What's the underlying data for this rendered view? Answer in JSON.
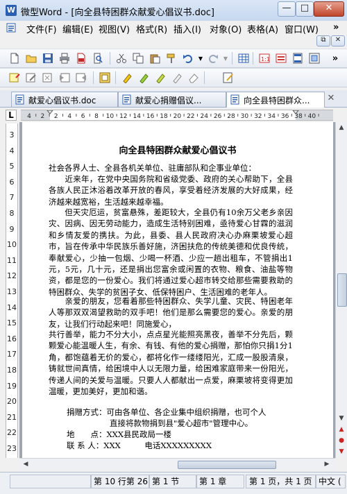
{
  "window": {
    "title": "微型Word - [向全县特困群众献爱心倡议书.doc]",
    "app_icon": "W",
    "min": "—",
    "max": "□",
    "close": "✕",
    "sub_restore": "⧉",
    "sub_close": "✕"
  },
  "menu": [
    {
      "label": "文件(F)"
    },
    {
      "label": "编辑(E)"
    },
    {
      "label": "视图(V)"
    },
    {
      "label": "格式(R)"
    },
    {
      "label": "插入(I)"
    },
    {
      "label": "对象(O)"
    },
    {
      "label": "表格(A)"
    },
    {
      "label": "窗口(W)"
    }
  ],
  "menu_overflow": "»",
  "toolbar1": [
    "new-doc-icon",
    "open-icon",
    "save-icon",
    "print-icon",
    "pdf-icon",
    "print-preview-icon",
    "cut-icon",
    "copy-icon",
    "paste-icon",
    "format-painter-icon",
    "undo-icon",
    "redo-icon",
    "table-icon",
    "page-setup-icon",
    "page-number-icon",
    "header-footer-icon",
    "zoom-icon"
  ],
  "toolbar2": [
    "new-note-icon",
    "edit-note-icon",
    "delete-note-icon",
    "prev-note-icon",
    "next-note-icon",
    "document-map-icon",
    "highlight-yellow-icon",
    "highlight-green-icon",
    "highlight-blue-icon",
    "clear-highlight-icon",
    "erase-icon",
    "track-changes-icon"
  ],
  "tabs": [
    {
      "label": "献爱心倡议书.doc",
      "active": false
    },
    {
      "label": "献爱心捐赠倡议...",
      "active": false
    },
    {
      "label": "向全县特困群众...",
      "active": true
    }
  ],
  "tab_close": "✕",
  "ruler": {
    "corner": "L",
    "h_labels": [
      "4",
      "2",
      "2",
      "4",
      "6",
      "8",
      "10",
      "12",
      "14",
      "16",
      "18",
      "20",
      "22",
      "24",
      "26",
      "28",
      "30",
      "32",
      "34",
      "36",
      "38",
      "40"
    ],
    "v_labels": [
      "3",
      "4",
      "5",
      "6",
      "7",
      "8",
      "9",
      "10",
      "11",
      "12",
      "13",
      "14",
      "15",
      "16",
      "17",
      "18",
      "19",
      "20",
      "21",
      "22",
      "23"
    ]
  },
  "document": {
    "title": "向全县特困群众献爱心倡议书",
    "salutation": "社会各界人士、全县各机关单位、驻庸部队和企事业单位：",
    "paragraphs": [
      "　　近来年，在党中央国务院和省级党委、政府的关心帮助下，全县各族人民正沐浴着改革开放的春风，享受着经济发展的大好成果，经济越来越宽裕，生活越来越幸福。",
      "　　但天灾厄运，贫富悬殊，差距较大，全县仍有10余万父老乡亲因灾、因病、因无劳动能力，造成生活特别困难，亟待爱心甘霖的滋润和乡情友爱的携扶。为此，县委、县人民政府决心办麻栗坡爱心超市，旨在传承中华民族乐善好施，济困扶危的传统美德和优良传统，奉献爱心，少抽一包烟、少喝一杯酒、少应一趟出租车，不管捐出1元，5元，几十元，还是捐出您富余或闲置的衣物、粮食、油盐等物资，都是您的一份爱心。我们将通过爱心超市转交给那些需要救助的特困群众、失学的贫困子女、低保特困户、生活困难的老年人。",
      "　　亲爱的朋友，您看着那些特困群众、失学儿童、灾民、特困老年人等那双双渴望救助的双手吧！他们是那么需要您的爱心。亲爱的朋友，让我们行动起来吧！同施爱心，",
      "共行善举，能力不分大小，点点星光能照亮黑夜，善举不分先后，颗颗爱心能温暖人生，有余、有钱、有他的爱心捐赠，那怕你只捐1分1角，都饱蕴着无价的爱心，都将化作一缕缕阳光，汇成一股股清泉，铸就世间真情，给困境中人以无限力量，给困难家庭带来一份阳光，传递人间的关爱与温暖。只要人人都献出一点爱，麻栗坡将变得更加温暖，更加美好，更加和谐。"
    ],
    "donation_label": "捐赠方式：",
    "donation_line1": "可由各单位、各企业集中组织捐赠，也可个人",
    "donation_line2": "直接将款物捐到县\"爱心超市\"管理中心。",
    "address": "地　　点：XXX县民政局一楼",
    "contact": "联 系 人：XXX　　　电话XXXXXXXXX"
  },
  "status": {
    "position": "第 10 行第 26",
    "section": "第 1 节",
    "chapter": "第 1 章",
    "pages": "第 1 页，共 1 页",
    "language": "中文 ("
  },
  "colors": {
    "titlebar": "#c6d7ee",
    "accent": "#2b5fb4",
    "page": "#ffffff",
    "workspace": "#a0a6ae"
  }
}
